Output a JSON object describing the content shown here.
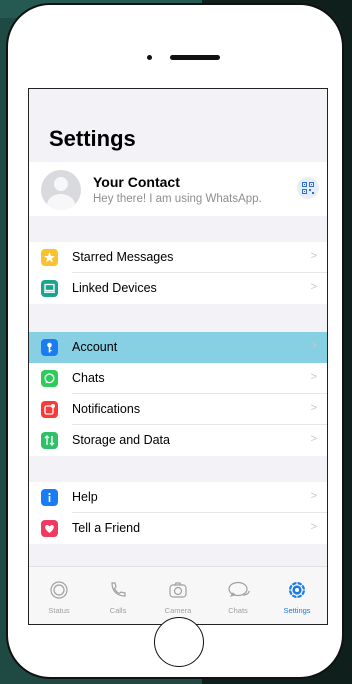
{
  "settings": {
    "title": "Settings"
  },
  "profile": {
    "name": "Your Contact",
    "status": "Hey there! I am using WhatsApp."
  },
  "groups": [
    {
      "items": [
        {
          "label": "Starred Messages",
          "icon": "star-icon",
          "color": "#f9c22e"
        },
        {
          "label": "Linked Devices",
          "icon": "laptop-icon",
          "color": "#18a48f"
        }
      ]
    },
    {
      "items": [
        {
          "label": "Account",
          "icon": "key-icon",
          "color": "#1a7cf2",
          "selected": true
        },
        {
          "label": "Chats",
          "icon": "whatsapp-icon",
          "color": "#2fcb5a"
        },
        {
          "label": "Notifications",
          "icon": "notification-icon",
          "color": "#f53b3b"
        },
        {
          "label": "Storage and Data",
          "icon": "storage-arrows-icon",
          "color": "#2fc16a"
        }
      ]
    },
    {
      "items": [
        {
          "label": "Help",
          "icon": "info-icon",
          "color": "#1a7cf2"
        },
        {
          "label": "Tell a Friend",
          "icon": "heart-icon",
          "color": "#f03a5f"
        }
      ]
    }
  ],
  "tabbar": {
    "tabs": [
      {
        "label": "Status",
        "icon": "status-icon"
      },
      {
        "label": "Calls",
        "icon": "phone-icon"
      },
      {
        "label": "Camera",
        "icon": "camera-icon"
      },
      {
        "label": "Chats",
        "icon": "chat-bubbles-icon"
      },
      {
        "label": "Settings",
        "icon": "settings-gear-icon",
        "active": true
      }
    ]
  },
  "colors": {
    "accent": "#1e7ae0",
    "selected_row": "#87cfe2",
    "background": "#f2f2f7"
  }
}
